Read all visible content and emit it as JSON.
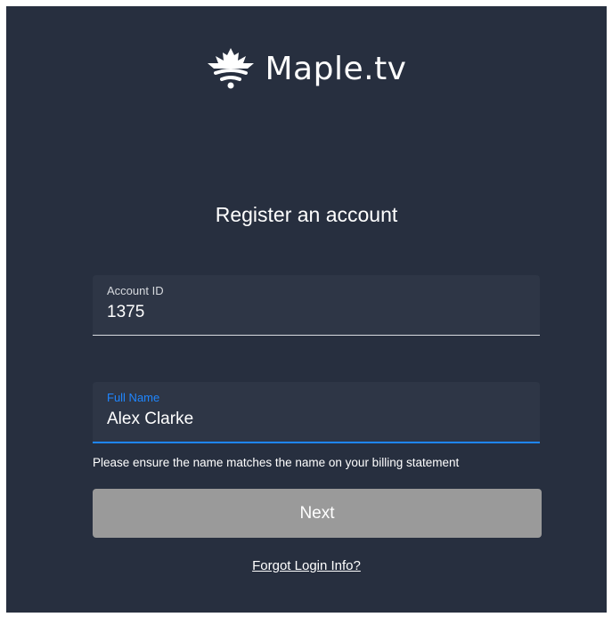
{
  "brand": {
    "name": "Maple.tv",
    "logo_icon": "maple-leaf-wifi-icon"
  },
  "form": {
    "title": "Register an account",
    "account_id": {
      "label": "Account ID",
      "value": "1375"
    },
    "full_name": {
      "label": "Full Name",
      "value": "Alex Clarke"
    },
    "helper_text": "Please ensure the name matches the name on your billing statement",
    "next_label": "Next",
    "forgot_label": "Forgot Login Info?"
  },
  "colors": {
    "background": "#272f3f",
    "field_background": "#2e3646",
    "focus_accent": "#1f86ff",
    "disabled_button": "#9a9a9a",
    "text": "#ffffff"
  }
}
